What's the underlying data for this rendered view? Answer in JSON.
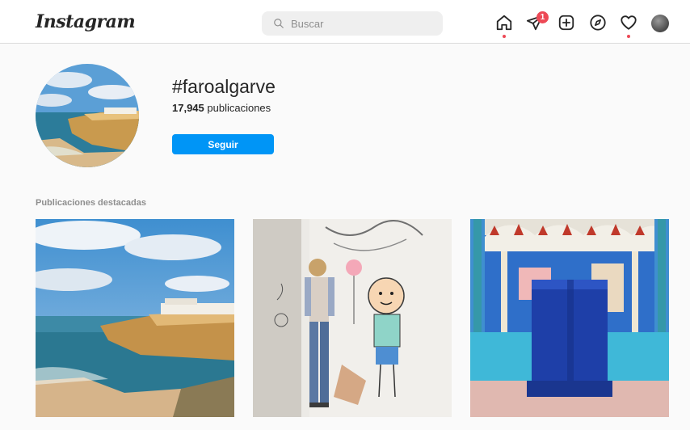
{
  "header": {
    "logo_text": "Instagram",
    "search_placeholder": "Buscar",
    "notification_count": "1",
    "icons": [
      "home-icon",
      "direct-icon",
      "new-post-icon",
      "explore-icon",
      "activity-icon",
      "profile-avatar"
    ],
    "colors": {
      "badge": "#ed4956",
      "accent": "#0095f6"
    }
  },
  "profile": {
    "hashtag": "#faroalgarve",
    "post_count": "17,945",
    "post_count_label": "publicaciones",
    "follow_label": "Seguir"
  },
  "featured": {
    "section_label": "Publicaciones destacadas",
    "posts": [
      {
        "subject": "coastal-cliffs"
      },
      {
        "subject": "woman-with-graffiti"
      },
      {
        "subject": "moorish-fountain"
      }
    ]
  }
}
